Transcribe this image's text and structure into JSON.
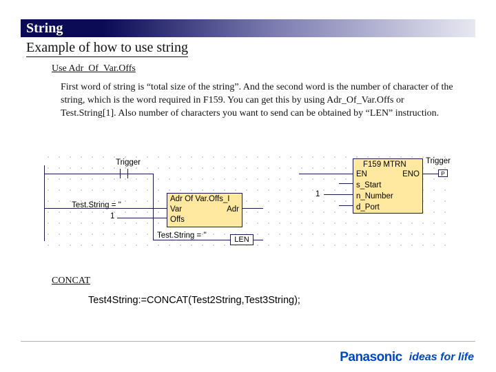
{
  "header": {
    "title": "String"
  },
  "subtitle": "Example of how to use string",
  "section1": {
    "heading": "Use Adr_Of_Var.Offs",
    "para": "First word of string is “total size of the string”.  And the second word is the number of character of the string, which is the word required in F159.  You can get this by using Adr_Of_Var.Offs or Test.String[1].\nAlso number of characters you want to send can be obtained by “LEN” instruction."
  },
  "diagram": {
    "trigger": "Trigger",
    "teststring_eq": "Test.String = ''",
    "one": "1",
    "adr_block": {
      "title": "Adr Of Var.Offs_I",
      "var": "Var",
      "adr": "Adr",
      "offs": "Offs"
    },
    "len": "LEN",
    "f159": {
      "title": "F159 MTRN",
      "en": "EN",
      "eno": "ENO",
      "s_start": "s_Start",
      "n_number": "n_Number",
      "d_port": "d_Port"
    }
  },
  "section2": {
    "heading": "CONCAT",
    "code": "Test4String:=CONCAT(Test2String,Test3String);"
  },
  "footer": {
    "brand": "Panasonic",
    "tagline": "ideas for life"
  }
}
